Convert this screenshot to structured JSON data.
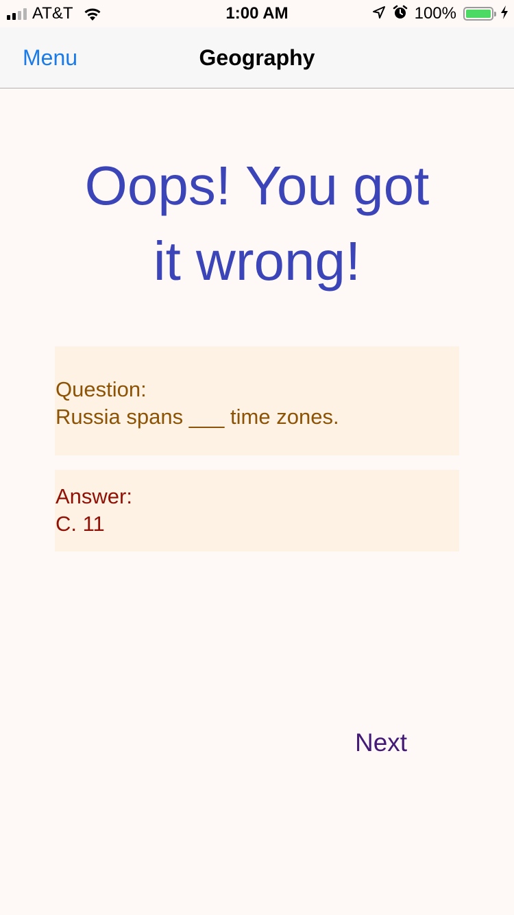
{
  "status_bar": {
    "carrier": "AT&T",
    "time": "1:00 AM",
    "battery_percent": "100%",
    "battery_level": 1.0,
    "signal_bars_filled": 2,
    "signal_bars_total": 4,
    "icons": [
      "signal-icon",
      "wifi-icon",
      "location-arrow-icon",
      "alarm-clock-icon",
      "battery-icon",
      "charging-bolt-icon"
    ]
  },
  "nav": {
    "back_label": "Menu",
    "title": "Geography"
  },
  "result": {
    "headline_line1": "Oops! You got",
    "headline_line2": "it wrong!"
  },
  "question_card": {
    "label": "Question:",
    "text": "Russia spans ___ time zones."
  },
  "answer_card": {
    "label": "Answer:",
    "text": "C. 11"
  },
  "actions": {
    "next_label": "Next"
  },
  "colors": {
    "background": "#fef8f6",
    "nav_link": "#1a7ae8",
    "headline": "#3c45b8",
    "card_background": "#fdf2e4",
    "question_text": "#8c5306",
    "answer_text": "#8f1106",
    "next_text": "#431a76",
    "battery_fill": "#4cd964"
  }
}
